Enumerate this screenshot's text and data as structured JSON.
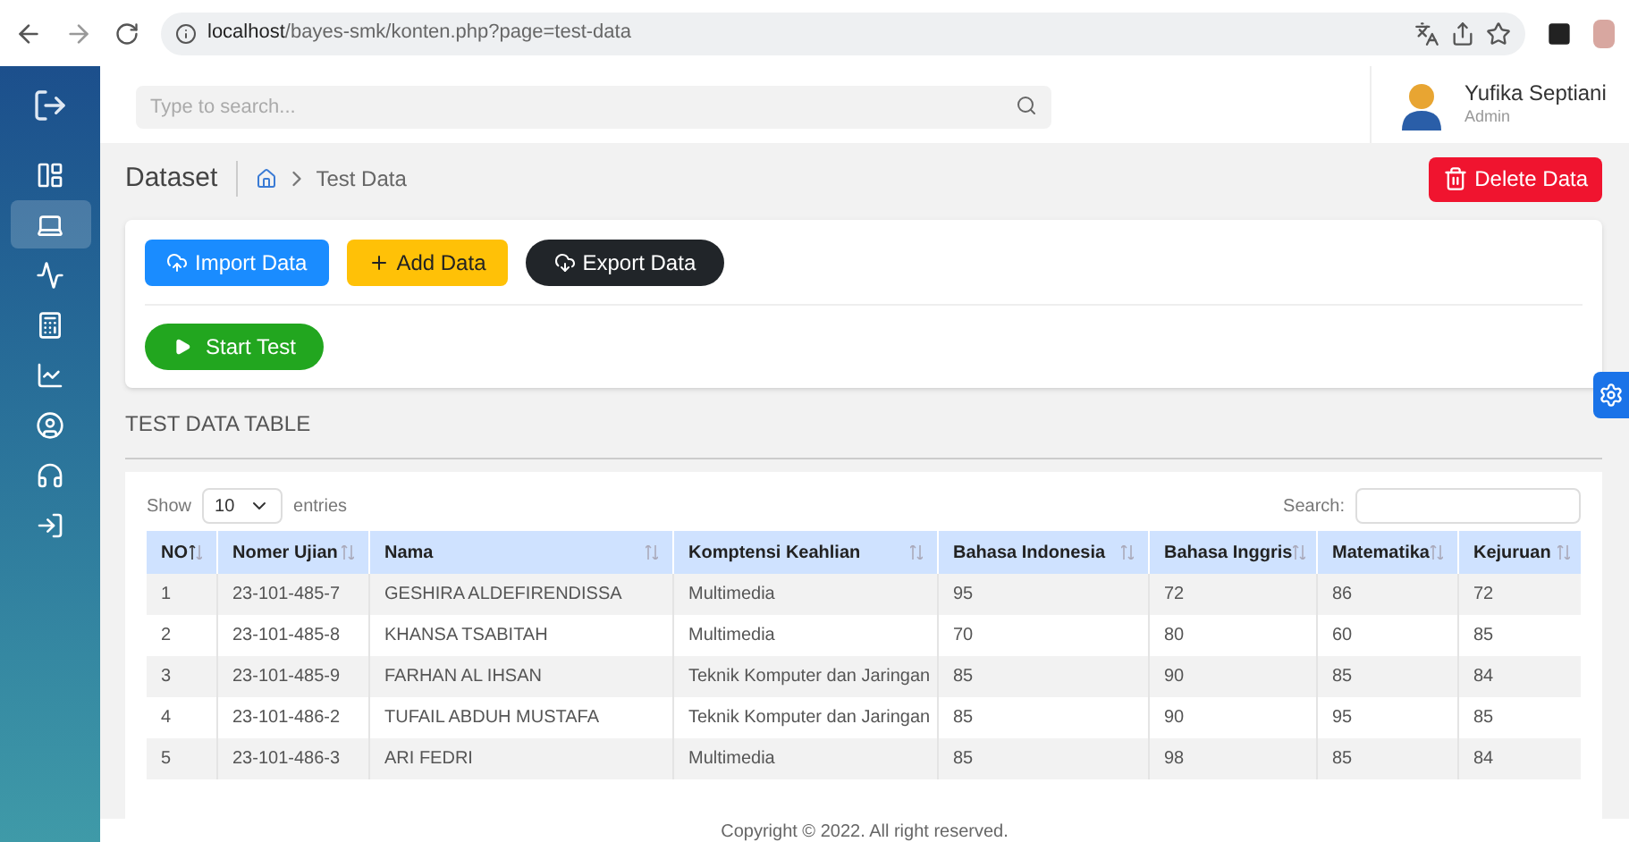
{
  "browser": {
    "url_host": "localhost",
    "url_path": "/bayes-smk/konten.php?page=test-data"
  },
  "sidebar": {
    "items": [
      {
        "selected": false
      },
      {
        "selected": true
      },
      {
        "selected": false
      },
      {
        "selected": false
      },
      {
        "selected": false
      },
      {
        "selected": false
      },
      {
        "selected": false
      },
      {
        "selected": false
      }
    ]
  },
  "header": {
    "search": {
      "placeholder": "Type to search..."
    },
    "user": {
      "name": "Yufika Septiani",
      "role": "Admin"
    }
  },
  "page": {
    "title": "Dataset",
    "breadcrumb": "Test Data",
    "delete_button": "Delete Data"
  },
  "actions": [
    {
      "label": "Import Data",
      "kind": "import"
    },
    {
      "label": "Add Data",
      "kind": "add"
    },
    {
      "label": "Export Data",
      "kind": "export"
    }
  ],
  "start_button": "Start Test",
  "section_title": "TEST DATA TABLE",
  "table": {
    "show_label": "Show",
    "page_size": "10",
    "entries_label": "entries",
    "search_label": "Search:",
    "columns": [
      {
        "label": "NO",
        "sorted": true
      },
      {
        "label": "Nomer Ujian",
        "sorted": false
      },
      {
        "label": "Nama",
        "sorted": false
      },
      {
        "label": "Komptensi Keahlian",
        "sorted": false
      },
      {
        "label": "Bahasa Indonesia",
        "sorted": false
      },
      {
        "label": "Bahasa Inggris",
        "sorted": false
      },
      {
        "label": "Matematika",
        "sorted": false
      },
      {
        "label": "Kejuruan",
        "sorted": false
      }
    ],
    "rows": [
      [
        "1",
        "23-101-485-7",
        "GESHIRA ALDEFIRENDISSA",
        "Multimedia",
        "95",
        "72",
        "86",
        "72"
      ],
      [
        "2",
        "23-101-485-8",
        "KHANSA TSABITAH",
        "Multimedia",
        "70",
        "80",
        "60",
        "85"
      ],
      [
        "3",
        "23-101-485-9",
        "FARHAN AL IHSAN",
        "Teknik Komputer dan Jaringan",
        "85",
        "90",
        "85",
        "84"
      ],
      [
        "4",
        "23-101-486-2",
        "TUFAIL ABDUH MUSTAFA",
        "Teknik Komputer dan Jaringan",
        "85",
        "90",
        "95",
        "85"
      ],
      [
        "5",
        "23-101-486-3",
        "ARI FEDRI",
        "Multimedia",
        "85",
        "98",
        "85",
        "84"
      ]
    ]
  },
  "footer": "Copyright © 2022. All right reserved."
}
